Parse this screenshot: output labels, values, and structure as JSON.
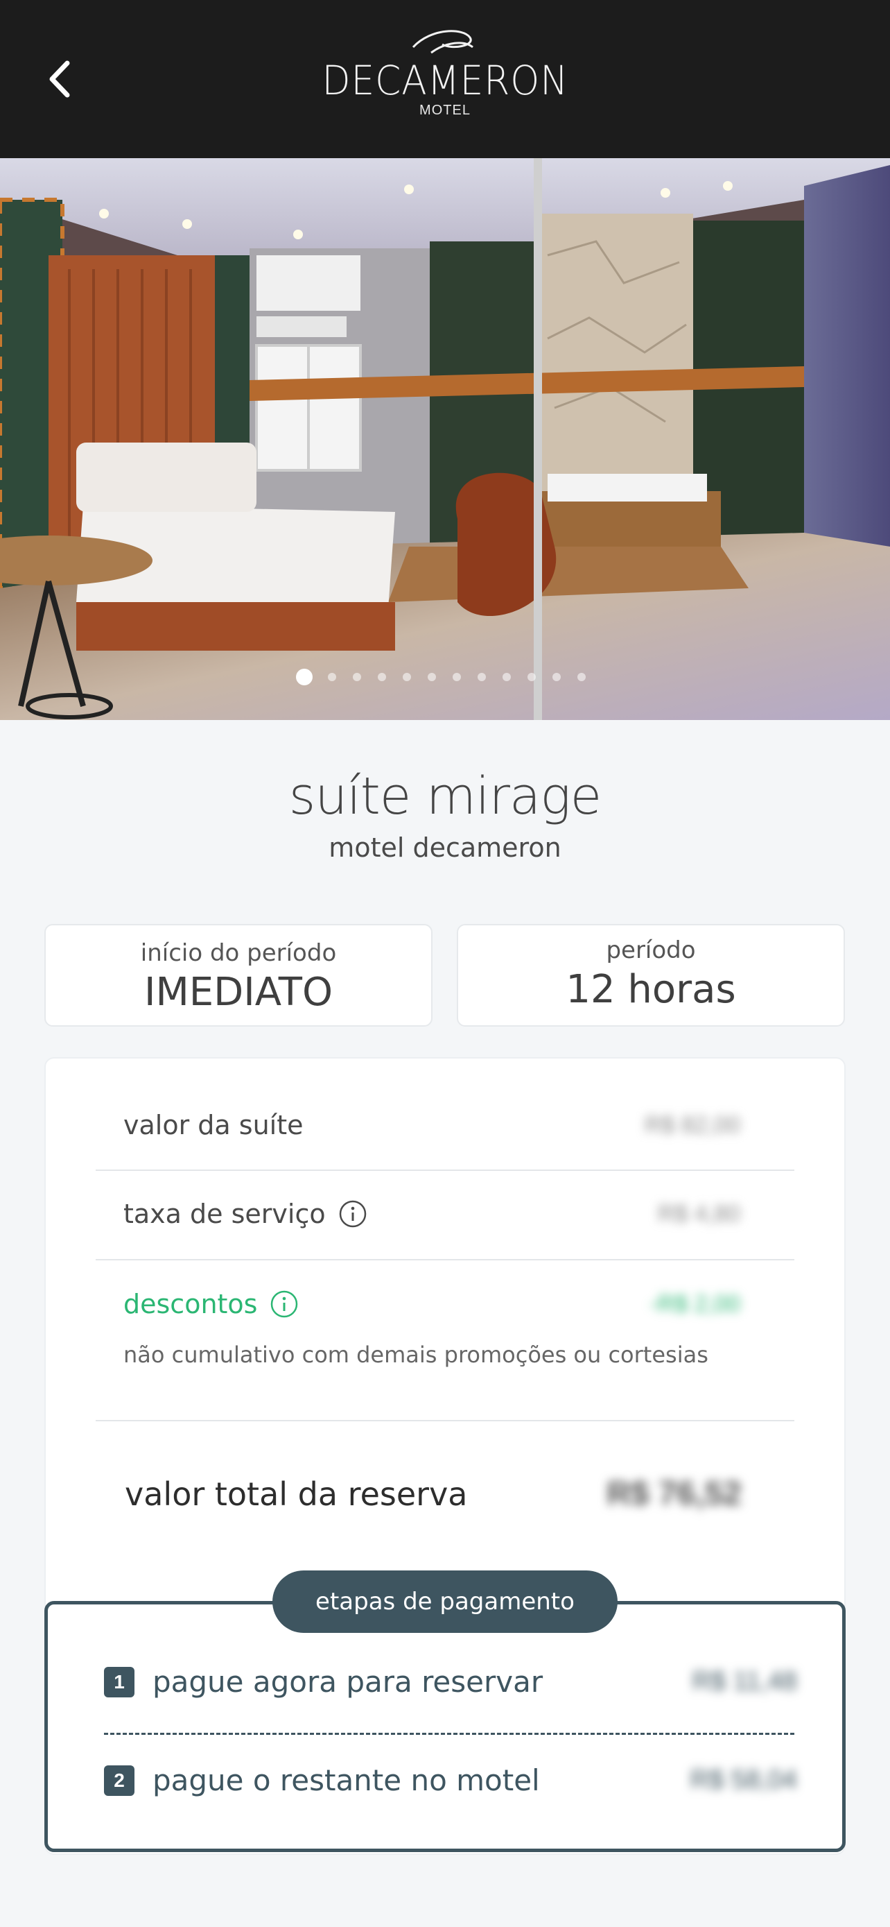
{
  "header": {
    "back_icon": "chevron-left-icon",
    "logo_name": "DECAMERON",
    "logo_sub": "MOTEL"
  },
  "gallery": {
    "slide_count": 12,
    "active_index": 0
  },
  "suite": {
    "title": "suíte mirage",
    "motel": "motel decameron"
  },
  "period": {
    "start_label": "início do período",
    "start_value": "IMEDIATO",
    "duration_label": "período",
    "duration_value": "12 horas"
  },
  "pricing": {
    "suite_label": "valor da suíte",
    "suite_amount": "R$ 82,00",
    "service_label": "taxa de serviço",
    "service_amount": "R$ 4,80",
    "discount_label": "descontos",
    "discount_amount": "-R$ 2,00",
    "discount_note": "não cumulativo com demais promoções ou cortesias",
    "total_label": "valor total da reserva",
    "total_amount": "R$ 76,52"
  },
  "payment_steps": {
    "title": "etapas de pagamento",
    "steps": [
      {
        "number": "1",
        "label": "pague agora para reservar",
        "amount": "R$ 11,48"
      },
      {
        "number": "2",
        "label": "pague o restante no motel",
        "amount": "R$ 58,04"
      }
    ]
  },
  "colors": {
    "header_bg": "#1c1c1c",
    "accent": "#3e5560",
    "discount": "#2bb673",
    "page_bg": "#f4f6f8"
  }
}
